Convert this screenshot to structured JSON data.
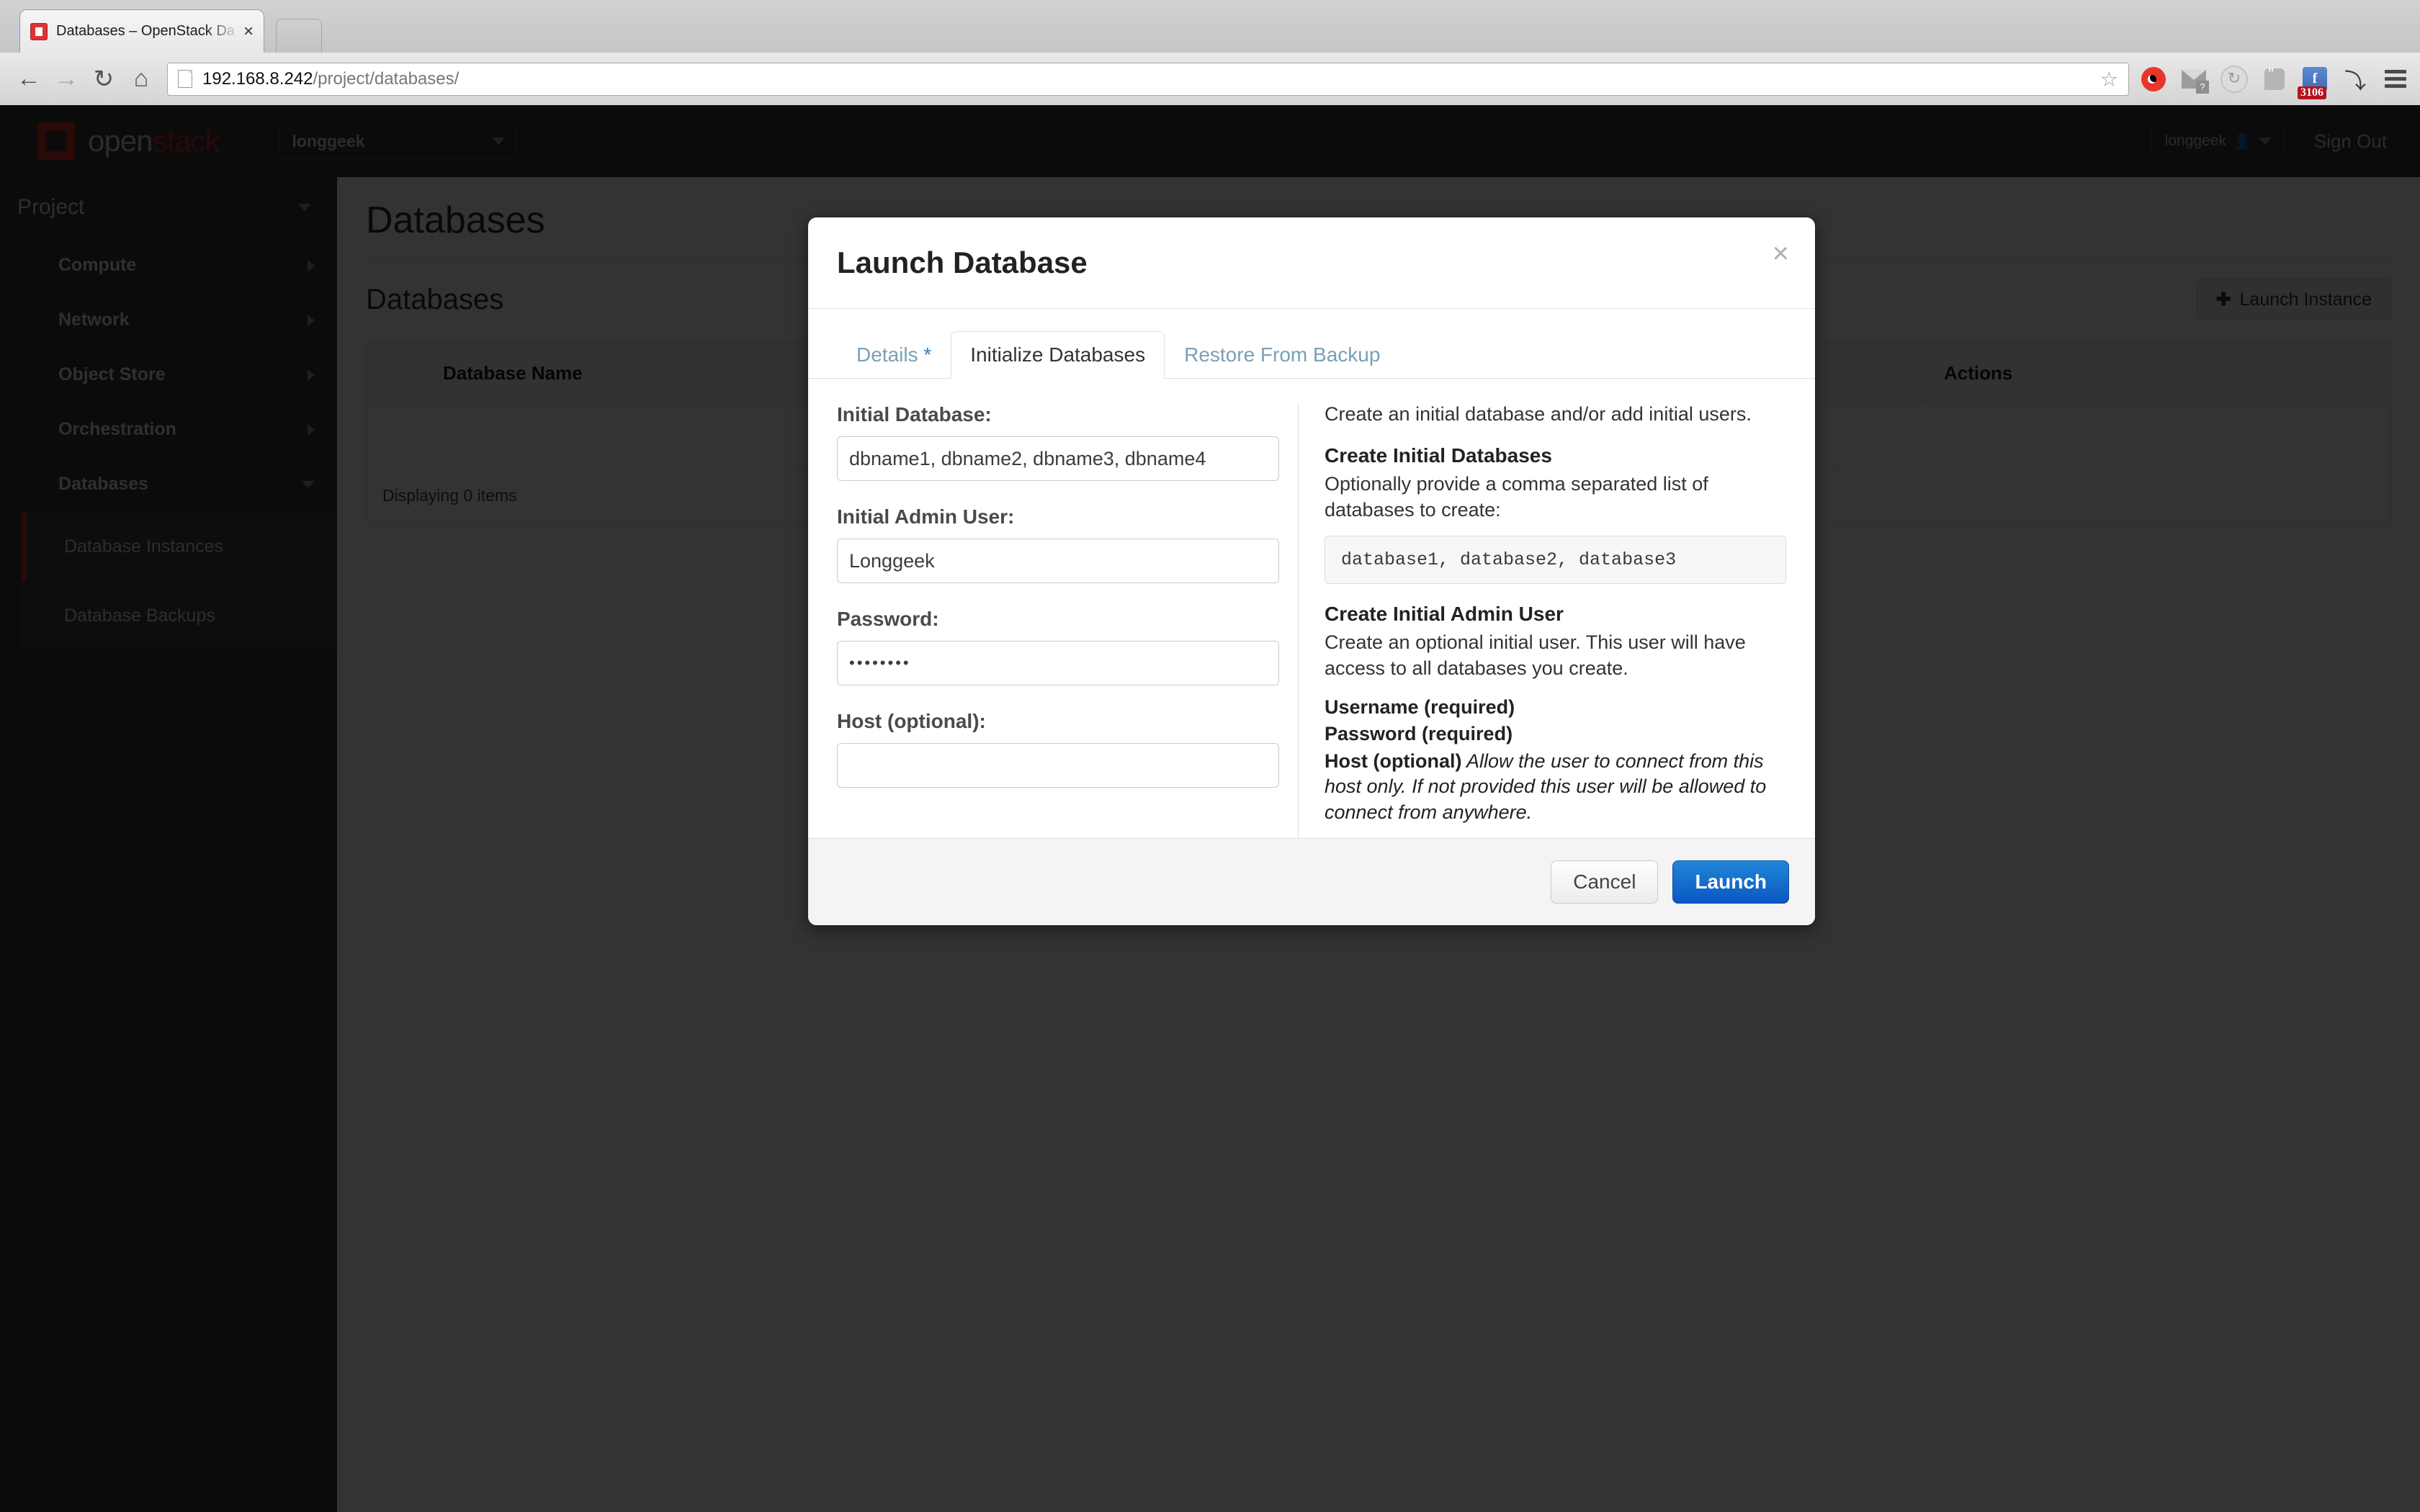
{
  "browser": {
    "tab": {
      "title": "Databases – OpenStack Da",
      "close_label": "×",
      "favicon": "openstack-favicon"
    },
    "new_tab_label": "",
    "nav": {
      "back": "←",
      "forward": "→",
      "reload": "↻",
      "home": "⌂"
    },
    "url": {
      "host": "192.168.8.242",
      "path": "/project/databases/",
      "bookmark_icon": "☆"
    },
    "extensions": [
      {
        "name": "weibo-icon"
      },
      {
        "name": "gmail-icon",
        "badge": "?"
      },
      {
        "name": "sync-icon"
      },
      {
        "name": "hangouts-icon"
      },
      {
        "name": "facebook-icon",
        "badge": "3106"
      },
      {
        "name": "download-icon"
      },
      {
        "name": "menu-icon"
      }
    ]
  },
  "header": {
    "logo": {
      "first": "open",
      "second": "stack"
    },
    "project_select": "longgeek",
    "user": "longgeek",
    "sign_out": "Sign Out"
  },
  "sidebar": {
    "section": "Project",
    "groups": [
      {
        "label": "Compute",
        "expanded": false
      },
      {
        "label": "Network",
        "expanded": false
      },
      {
        "label": "Object Store",
        "expanded": false
      },
      {
        "label": "Orchestration",
        "expanded": false
      },
      {
        "label": "Databases",
        "expanded": true
      }
    ],
    "sub_items": [
      {
        "label": "Database Instances",
        "active": true
      },
      {
        "label": "Database Backups",
        "active": false
      }
    ]
  },
  "content": {
    "page_title": "Databases",
    "section_title": "Databases",
    "launch_instance_button": "Launch Instance",
    "launch_instance_icon": "✚",
    "table": {
      "columns": [
        "Database Name",
        "Actions"
      ],
      "rows": [],
      "footer": "Displaying 0 items"
    }
  },
  "modal": {
    "title": "Launch Database",
    "close_label": "×",
    "tabs": [
      {
        "label": "Details",
        "required_marker": "*",
        "active": false
      },
      {
        "label": "Initialize Databases",
        "required_marker": "",
        "active": true
      },
      {
        "label": "Restore From Backup",
        "required_marker": "",
        "active": false
      }
    ],
    "form": {
      "fields": [
        {
          "label": "Initial Database:",
          "value": "dbname1, dbname2, dbname3, dbname4",
          "type": "text"
        },
        {
          "label": "Initial Admin User:",
          "value": "Longgeek",
          "type": "text"
        },
        {
          "label": "Password:",
          "value": "••••••••",
          "type": "password"
        },
        {
          "label": "Host (optional):",
          "value": "",
          "type": "text"
        }
      ]
    },
    "help": {
      "intro": "Create an initial database and/or add initial users.",
      "databases_heading": "Create Initial Databases",
      "databases_text": "Optionally provide a comma separated list of databases to create:",
      "databases_code": "database1, database2, database3",
      "admin_heading": "Create Initial Admin User",
      "admin_text": "Create an optional initial user. This user will have access to all databases you create.",
      "username_label": "Username (required)",
      "password_label": "Password (required)",
      "host_label": "Host (optional)",
      "host_text": " Allow the user to connect from this host only. If not provided this user will be allowed to connect from anywhere."
    },
    "footer": {
      "cancel": "Cancel",
      "launch": "Launch"
    }
  },
  "colors": {
    "brand_red": "#cf2e2e",
    "primary_blue": "#0a57c2",
    "tab_link": "#7aa0b8",
    "header_dark": "#3a3a3a"
  }
}
